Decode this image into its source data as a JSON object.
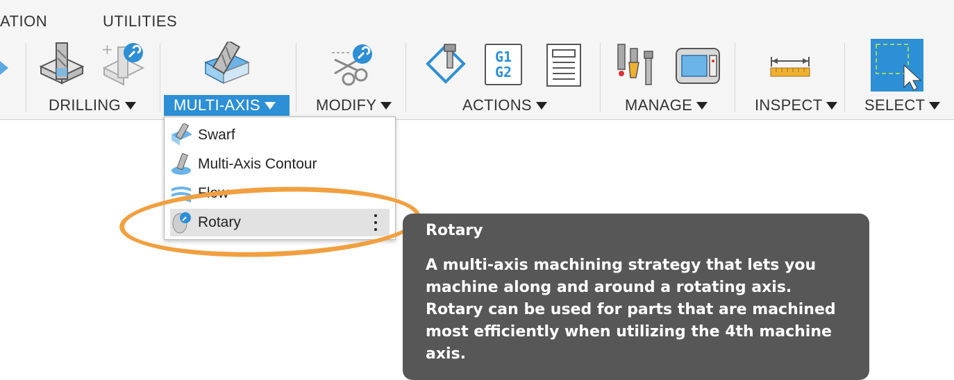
{
  "tabs": [
    "ATION",
    "UTILITIES"
  ],
  "groups": {
    "drilling": "DRILLING",
    "multi_axis": "MULTI-AXIS",
    "modify": "MODIFY",
    "actions": "ACTIONS",
    "manage": "MANAGE",
    "inspect": "INSPECT",
    "select": "SELECT"
  },
  "icons": {
    "actions_g1": "G1",
    "actions_g2": "G2"
  },
  "multi_axis_menu": {
    "items": [
      "Swarf",
      "Multi-Axis Contour",
      "Flow",
      "Rotary"
    ]
  },
  "tooltip": {
    "title": "Rotary",
    "body": "A multi-axis machining strategy that lets you machine along and around a rotating axis. Rotary can be used for parts that are machined most efficiently when utilizing the 4th machine axis."
  },
  "colors": {
    "accent": "#2d8fd5",
    "tooltip_bg": "#575757",
    "highlight": "#f0a040"
  }
}
